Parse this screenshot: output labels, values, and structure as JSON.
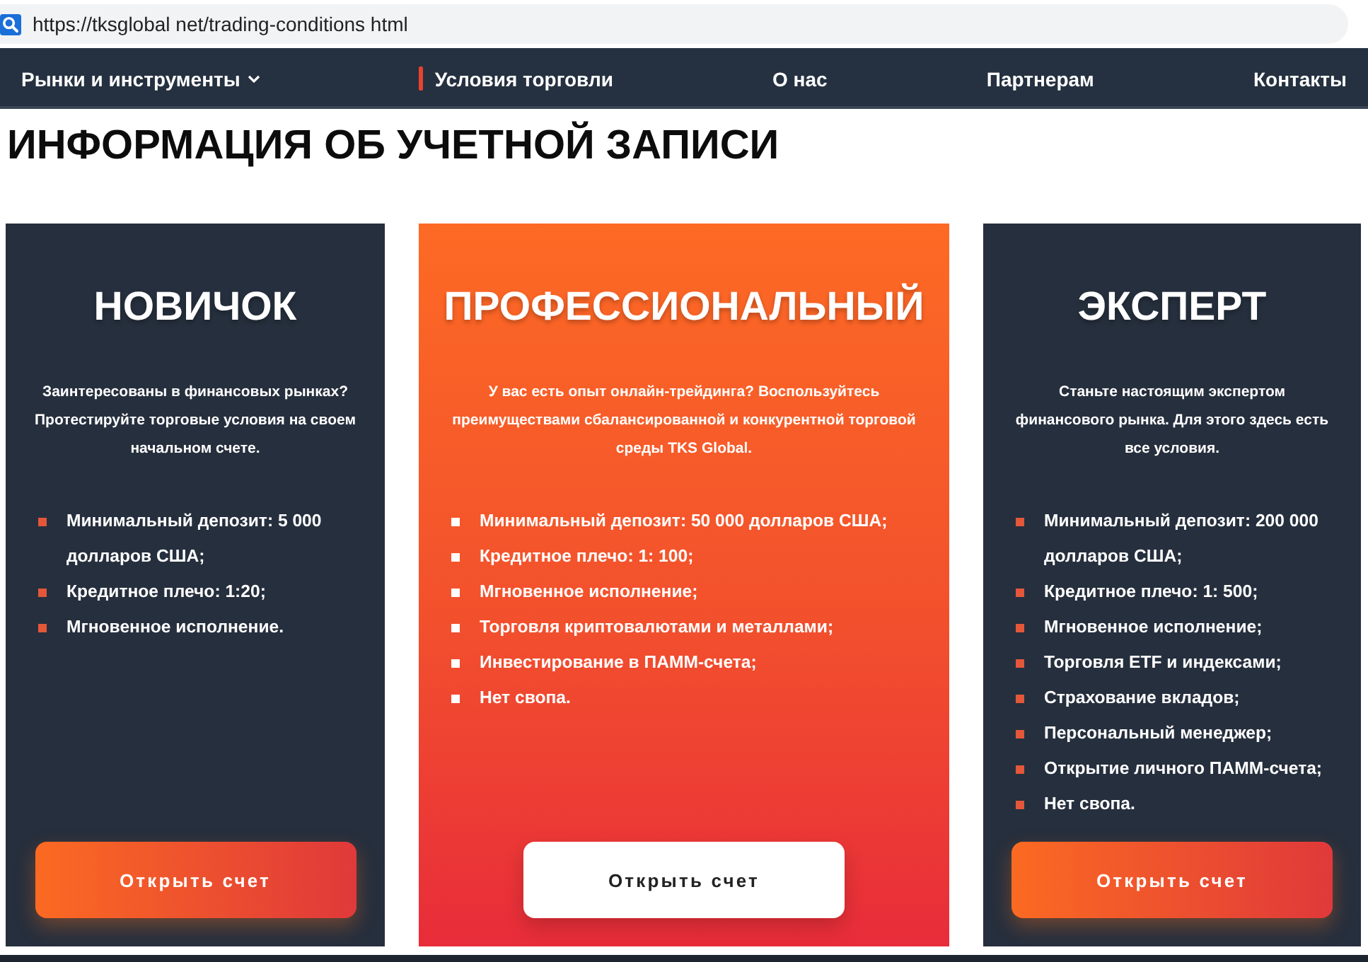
{
  "address_bar": {
    "url": "https://tksglobal net/trading-conditions html"
  },
  "nav": {
    "items": [
      {
        "label": "Рынки и инструменты",
        "selected": false,
        "dropdown": true
      },
      {
        "label": "Условия торговли",
        "selected": true,
        "dropdown": false
      },
      {
        "label": "О нас",
        "selected": false,
        "dropdown": false
      },
      {
        "label": "Партнерам",
        "selected": false,
        "dropdown": false
      },
      {
        "label": "Контакты",
        "selected": false,
        "dropdown": false
      }
    ]
  },
  "heading": "ИНФОРМАЦИЯ ОБ УЧЕТНОЙ ЗАПИСИ",
  "plans": [
    {
      "title": "НОВИЧОК",
      "featured": false,
      "description": "Заинтересованы в финансовых рынках? Протестируйте торговые условия на своем начальном счете.",
      "features": [
        "Минимальный депозит: 5 000 долларов США;",
        "Кредитное плечо: 1:20;",
        "Мгновенное исполнение."
      ],
      "button": "Открыть счет"
    },
    {
      "title": "ПРОФЕССИОНАЛЬНЫЙ",
      "featured": true,
      "description": "У вас есть опыт онлайн-трейдинга? Воспользуйтесь преимуществами сбалансированной и конкурентной торговой среды TKS Global.",
      "features": [
        "Минимальный депозит: 50 000 долларов США;",
        "Кредитное плечо: 1: 100;",
        "Мгновенное исполнение;",
        "Торговля криптовалютами и металлами;",
        "Инвестирование в ПАММ-счета;",
        "Нет свопа."
      ],
      "button": "Открыть счет"
    },
    {
      "title": "ЭКСПЕРТ",
      "featured": false,
      "description": "Станьте настоящим экспертом финансового рынка. Для этого здесь есть все условия.",
      "features": [
        "Минимальный депозит: 200 000 долларов США;",
        "Кредитное плечо: 1: 500;",
        "Мгновенное исполнение;",
        "Торговля ETF и индексами;",
        "Страхование вкладов;",
        "Персональный менеджер;",
        "Открытие личного ПАММ-счета;",
        "Нет свопа."
      ],
      "button": "Открыть счет"
    }
  ]
}
